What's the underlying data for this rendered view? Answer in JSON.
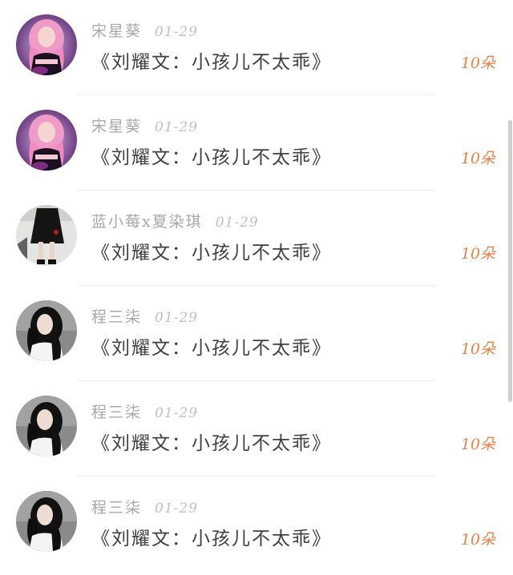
{
  "list": {
    "items": [
      {
        "sender": "宋星葵",
        "date": "01-29",
        "message": "《刘耀文：小孩儿不太乖》",
        "amount": "10朵",
        "avatar": "pink-hair-girl-avatar"
      },
      {
        "sender": "宋星葵",
        "date": "01-29",
        "message": "《刘耀文：小孩儿不太乖》",
        "amount": "10朵",
        "avatar": "pink-hair-girl-avatar"
      },
      {
        "sender": "蓝小莓x夏染琪",
        "date": "01-29",
        "message": "《刘耀文：小孩儿不太乖》",
        "amount": "10朵",
        "avatar": "black-dress-legs-avatar"
      },
      {
        "sender": "程三柒",
        "date": "01-29",
        "message": "《刘耀文：小孩儿不太乖》",
        "amount": "10朵",
        "avatar": "dark-hair-girl-avatar"
      },
      {
        "sender": "程三柒",
        "date": "01-29",
        "message": "《刘耀文：小孩儿不太乖》",
        "amount": "10朵",
        "avatar": "dark-hair-girl-avatar"
      },
      {
        "sender": "程三柒",
        "date": "01-29",
        "message": "《刘耀文：小孩儿不太乖》",
        "amount": "10朵",
        "avatar": "dark-hair-girl-avatar"
      }
    ]
  },
  "colors": {
    "amount": "#e8834a",
    "name": "#a8a8a8",
    "message": "#3f3f3f"
  }
}
